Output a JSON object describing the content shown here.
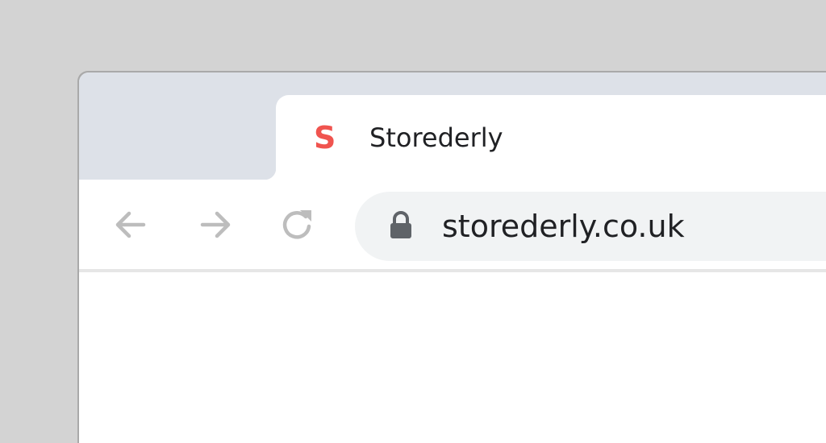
{
  "tab": {
    "favicon_letter": "S",
    "favicon_icon": "storederly-logo-icon",
    "title": "Storederly"
  },
  "toolbar": {
    "back_icon": "arrow-left-icon",
    "forward_icon": "arrow-right-icon",
    "reload_icon": "reload-icon"
  },
  "address_bar": {
    "security_icon": "lock-icon",
    "url": "storederly.co.uk"
  },
  "colors": {
    "background": "#d3d3d3",
    "tab_strip": "#dde1e8",
    "omnibox": "#f1f3f4",
    "favicon_red": "#f0544f",
    "nav_icon": "#bdbdbd",
    "text": "#202124"
  }
}
